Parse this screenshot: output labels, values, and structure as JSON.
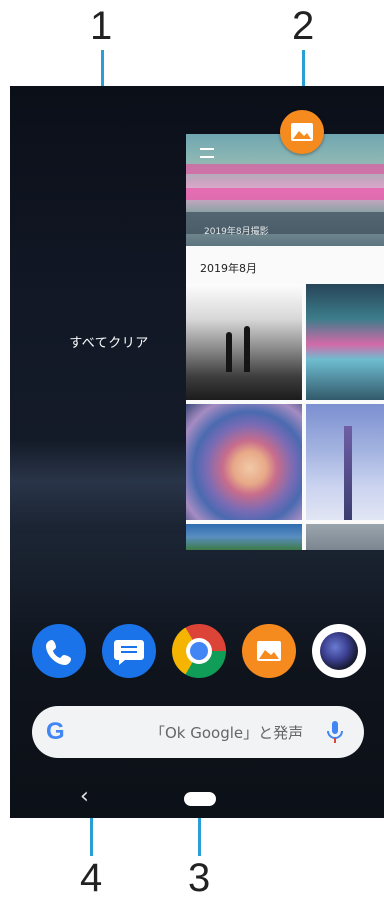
{
  "callouts": [
    "1",
    "2",
    "3",
    "4"
  ],
  "recents": {
    "clear_all_label": "すべてクリア",
    "card": {
      "app_icon": "album-app-icon",
      "header_caption": "2019年8月撮影",
      "month_label": "2019年8月"
    }
  },
  "dock": {
    "apps": [
      "phone-icon",
      "messages-icon",
      "chrome-icon",
      "album-icon",
      "xperia-lens-icon"
    ]
  },
  "search": {
    "g_label": "G",
    "hint": "「Ok Google」と発声"
  },
  "nav": {
    "back_icon": "back-icon",
    "back_glyph": "‹",
    "home": "home-pill"
  },
  "colors": {
    "callout_line": "#2a9fd6",
    "album_orange": "#f58a1f",
    "google_blue": "#4285f4"
  }
}
